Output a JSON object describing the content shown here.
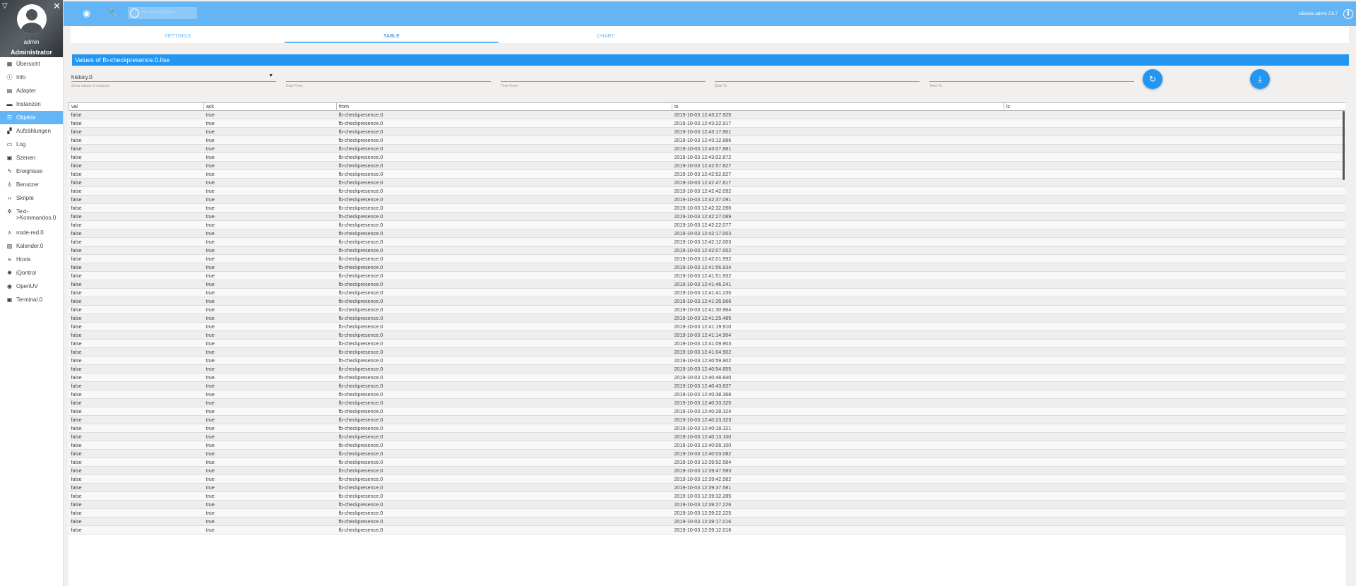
{
  "sidebar": {
    "user": "admin",
    "role": "Administrator",
    "items": [
      {
        "label": "Übersicht",
        "icon": "grid-icon"
      },
      {
        "label": "Info",
        "icon": "info-icon"
      },
      {
        "label": "Adapter",
        "icon": "store-icon"
      },
      {
        "label": "Instanzen",
        "icon": "instances-icon"
      },
      {
        "label": "Objekte",
        "icon": "list-icon",
        "active": true
      },
      {
        "label": "Aufzählungen",
        "icon": "enums-icon"
      },
      {
        "label": "Log",
        "icon": "log-icon"
      },
      {
        "label": "Szenen",
        "icon": "scenes-icon"
      },
      {
        "label": "Ereignisse",
        "icon": "lightning-icon"
      },
      {
        "label": "Benutzer",
        "icon": "user-icon"
      },
      {
        "label": "Skripte",
        "icon": "code-icon"
      },
      {
        "label": "Text->Kommandos.0",
        "icon": "gear-icon",
        "tall": true
      },
      {
        "label": "node-red.0",
        "icon": "node-red-icon"
      },
      {
        "label": "Kalender.0",
        "icon": "calendar-icon"
      },
      {
        "label": "Hosts",
        "icon": "hosts-icon"
      },
      {
        "label": "iQontrol",
        "icon": "iqontrol-icon"
      },
      {
        "label": "OpenUV",
        "icon": "sun-icon"
      },
      {
        "label": "Terminal.0",
        "icon": "terminal-icon"
      }
    ]
  },
  "topbar": {
    "search_placeholder": "Reset Adapters",
    "version": "ioBroker.admin 3.6.7"
  },
  "tabs": [
    "SETTINGS",
    "TABLE",
    "CHART"
  ],
  "active_tab": 1,
  "panel_title": "Values of fb-checkpresence.0.Ilse",
  "filters": {
    "instance": "history.0",
    "instance_label": "Show values of instance",
    "date_from": "Date From",
    "time_from": "Time From",
    "date_to": "Date To",
    "time_to": "Time To"
  },
  "table": {
    "columns": [
      "val",
      "ack",
      "from",
      "ts",
      "lc"
    ],
    "rows": [
      [
        "false",
        "true",
        "fb-checkpresence.0",
        "2019-10-03 12:43:27.925",
        ""
      ],
      [
        "false",
        "true",
        "fb-checkpresence.0",
        "2019-10-03 12:43:22.917",
        ""
      ],
      [
        "false",
        "true",
        "fb-checkpresence.0",
        "2019-10-03 12:43:17.901",
        ""
      ],
      [
        "false",
        "true",
        "fb-checkpresence.0",
        "2019-10-03 12:43:12.886",
        ""
      ],
      [
        "false",
        "true",
        "fb-checkpresence.0",
        "2019-10-03 12:43:07.881",
        ""
      ],
      [
        "false",
        "true",
        "fb-checkpresence.0",
        "2019-10-03 12:43:02.872",
        ""
      ],
      [
        "false",
        "true",
        "fb-checkpresence.0",
        "2019-10-03 12:42:57.827",
        ""
      ],
      [
        "false",
        "true",
        "fb-checkpresence.0",
        "2019-10-03 12:42:52.827",
        ""
      ],
      [
        "false",
        "true",
        "fb-checkpresence.0",
        "2019-10-03 12:42:47.817",
        ""
      ],
      [
        "false",
        "true",
        "fb-checkpresence.0",
        "2019-10-03 12:42:42.092",
        ""
      ],
      [
        "false",
        "true",
        "fb-checkpresence.0",
        "2019-10-03 12:42:37.091",
        ""
      ],
      [
        "false",
        "true",
        "fb-checkpresence.0",
        "2019-10-03 12:42:32.090",
        ""
      ],
      [
        "false",
        "true",
        "fb-checkpresence.0",
        "2019-10-03 12:42:27.089",
        ""
      ],
      [
        "false",
        "true",
        "fb-checkpresence.0",
        "2019-10-03 12:42:22.077",
        ""
      ],
      [
        "false",
        "true",
        "fb-checkpresence.0",
        "2019-10-03 12:42:17.003",
        ""
      ],
      [
        "false",
        "true",
        "fb-checkpresence.0",
        "2019-10-03 12:42:12.003",
        ""
      ],
      [
        "false",
        "true",
        "fb-checkpresence.0",
        "2019-10-03 12:42:07.002",
        ""
      ],
      [
        "false",
        "true",
        "fb-checkpresence.0",
        "2019-10-03 12:42:01.992",
        ""
      ],
      [
        "false",
        "true",
        "fb-checkpresence.0",
        "2019-10-03 12:41:56.934",
        ""
      ],
      [
        "false",
        "true",
        "fb-checkpresence.0",
        "2019-10-03 12:41:51.932",
        ""
      ],
      [
        "false",
        "true",
        "fb-checkpresence.0",
        "2019-10-03 12:41:46.241",
        ""
      ],
      [
        "false",
        "true",
        "fb-checkpresence.0",
        "2019-10-03 12:41:41.235",
        ""
      ],
      [
        "false",
        "true",
        "fb-checkpresence.0",
        "2019-10-03 12:41:35.966",
        ""
      ],
      [
        "false",
        "true",
        "fb-checkpresence.0",
        "2019-10-03 12:41:30.964",
        ""
      ],
      [
        "false",
        "true",
        "fb-checkpresence.0",
        "2019-10-03 12:41:25.485",
        ""
      ],
      [
        "false",
        "true",
        "fb-checkpresence.0",
        "2019-10-03 12:41:19.910",
        ""
      ],
      [
        "false",
        "true",
        "fb-checkpresence.0",
        "2019-10-03 12:41:14.904",
        ""
      ],
      [
        "false",
        "true",
        "fb-checkpresence.0",
        "2019-10-03 12:41:09.903",
        ""
      ],
      [
        "false",
        "true",
        "fb-checkpresence.0",
        "2019-10-03 12:41:04.902",
        ""
      ],
      [
        "false",
        "true",
        "fb-checkpresence.0",
        "2019-10-03 12:40:59.902",
        ""
      ],
      [
        "false",
        "true",
        "fb-checkpresence.0",
        "2019-10-03 12:40:54.855",
        ""
      ],
      [
        "false",
        "true",
        "fb-checkpresence.0",
        "2019-10-03 12:40:48.840",
        ""
      ],
      [
        "false",
        "true",
        "fb-checkpresence.0",
        "2019-10-03 12:40:43.837",
        ""
      ],
      [
        "false",
        "true",
        "fb-checkpresence.0",
        "2019-10-03 12:40:38.368",
        ""
      ],
      [
        "false",
        "true",
        "fb-checkpresence.0",
        "2019-10-03 12:40:33.325",
        ""
      ],
      [
        "false",
        "true",
        "fb-checkpresence.0",
        "2019-10-03 12:40:28.324",
        ""
      ],
      [
        "false",
        "true",
        "fb-checkpresence.0",
        "2019-10-03 12:40:23.323",
        ""
      ],
      [
        "false",
        "true",
        "fb-checkpresence.0",
        "2019-10-03 12:40:18.321",
        ""
      ],
      [
        "false",
        "true",
        "fb-checkpresence.0",
        "2019-10-03 12:40:13.100",
        ""
      ],
      [
        "false",
        "true",
        "fb-checkpresence.0",
        "2019-10-03 12:40:08.100",
        ""
      ],
      [
        "false",
        "true",
        "fb-checkpresence.0",
        "2019-10-03 12:40:03.082",
        ""
      ],
      [
        "false",
        "true",
        "fb-checkpresence.0",
        "2019-10-03 12:39:52.584",
        ""
      ],
      [
        "false",
        "true",
        "fb-checkpresence.0",
        "2019-10-03 12:39:47.583",
        ""
      ],
      [
        "false",
        "true",
        "fb-checkpresence.0",
        "2019-10-03 12:39:42.582",
        ""
      ],
      [
        "false",
        "true",
        "fb-checkpresence.0",
        "2019-10-03 12:39:37.581",
        ""
      ],
      [
        "false",
        "true",
        "fb-checkpresence.0",
        "2019-10-03 12:39:32.285",
        ""
      ],
      [
        "false",
        "true",
        "fb-checkpresence.0",
        "2019-10-03 12:39:27.226",
        ""
      ],
      [
        "false",
        "true",
        "fb-checkpresence.0",
        "2019-10-03 12:39:22.225",
        ""
      ],
      [
        "false",
        "true",
        "fb-checkpresence.0",
        "2019-10-03 12:39:17.016",
        ""
      ],
      [
        "false",
        "true",
        "fb-checkpresence.0",
        "2019-10-03 12:39:12.016",
        ""
      ]
    ]
  },
  "colors": {
    "accent": "#64b5f6",
    "primary": "#2196f3"
  }
}
